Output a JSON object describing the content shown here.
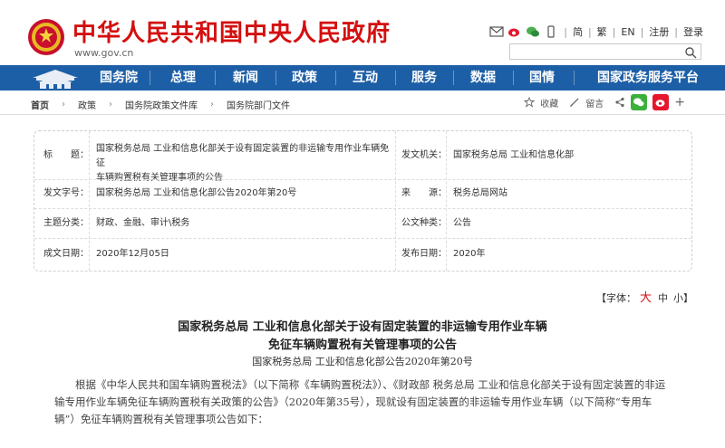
{
  "header": {
    "site_title": "中华人民共和国中央人民政府",
    "site_domain": "www.gov.cn",
    "links": [
      "简",
      "繁",
      "EN",
      "注册",
      "登录"
    ],
    "search_placeholder": ""
  },
  "nav": {
    "items": [
      "国务院",
      "总理",
      "新闻",
      "政策",
      "互动",
      "服务",
      "数据",
      "国情",
      "国家政务服务平台"
    ]
  },
  "breadcrumb": [
    "首页",
    "政策",
    "国务院政策文件库",
    "国务院部门文件"
  ],
  "tools": {
    "favorite": "收藏",
    "comment": "留言"
  },
  "info": {
    "title_label": "标　　题：",
    "title_value_1": "国家税务总局  工业和信息化部关于设有固定装置的非运输专用作业车辆免征",
    "title_value_2": "车辆购置税有关管理事项的公告",
    "issuer_label": "发文机关：",
    "issuer_value": "国家税务总局  工业和信息化部",
    "docno_label": "发文字号：",
    "docno_value": "国家税务总局  工业和信息化部公告2020年第20号",
    "source_label": "来　　源：",
    "source_value": "税务总局网站",
    "category_label": "主题分类：",
    "category_value": "财政、金融、审计\\税务",
    "type_label": "公文种类：",
    "type_value": "公告",
    "date_label": "成文日期：",
    "date_value": "2020年12月05日",
    "pub_label": "发布日期：",
    "pub_value": "2020年"
  },
  "fontsize": {
    "label": "【字体：",
    "big": "大",
    "mid": "中",
    "small": "小】"
  },
  "article": {
    "title_1": "国家税务总局  工业和信息化部关于设有固定装置的非运输专用作业车辆",
    "title_2": "免征车辆购置税有关管理事项的公告",
    "doc_no": "国家税务总局  工业和信息化部公告2020年第20号",
    "body": "根据《中华人民共和国车辆购置税法》（以下简称《车辆购置税法》）、《财政部  税务总局  工业和信息化部关于设有固定装置的非运输专用作业车辆免征车辆购置税有关政策的公告》（2020年第35号），现就设有固定装置的非运输专用作业车辆（以下简称“专用车辆”）免征车辆购置税有关管理事项公告如下："
  },
  "colors": {
    "brand_red": "#d40f0f",
    "nav_blue": "#1d5fa6"
  }
}
